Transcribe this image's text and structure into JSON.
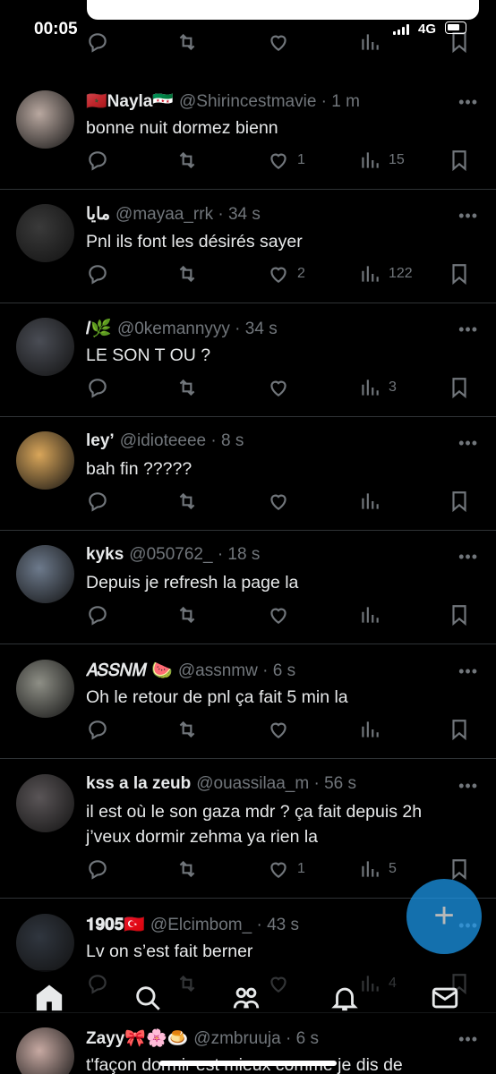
{
  "status_bar": {
    "time": "00:05",
    "network": "4G"
  },
  "colors": {
    "background": "#000000",
    "text": "#e7e9ea",
    "muted": "#71767b",
    "accent": "#1d9bf0",
    "divider": "#2f3336"
  },
  "tweets": [
    {
      "name": "🇲🇦Nayla🇸🇾",
      "handle": "@Shirincestmavie · 1 m",
      "text": "bonne nuit dormez bienn",
      "likes": "1",
      "views": "15"
    },
    {
      "name": "مايا",
      "handle": "@mayaa_rrk · 34 s",
      "text": "Pnl ils font les désirés sayer",
      "likes": "2",
      "views": "122"
    },
    {
      "name": "𝐼🌿",
      "handle": "@0kemannyyy · 34 s",
      "text": "LE SON T OU ?",
      "likes": "",
      "views": "3"
    },
    {
      "name": "ley’",
      "handle": "@idioteeee · 8 s",
      "text": "bah fin ?????",
      "likes": "",
      "views": ""
    },
    {
      "name": "kyks",
      "handle": "@050762_ · 18 s",
      "text": "Depuis je refresh la page la",
      "likes": "",
      "views": ""
    },
    {
      "name": "𝐴𝑆𝑆𝑁𝑀 🍉",
      "handle": "@assnmw · 6 s",
      "text": "Oh le retour de pnl ça fait 5 min la",
      "likes": "",
      "views": ""
    },
    {
      "name": "kss a la zeub",
      "handle": "@ouassilaa_m · 56 s",
      "text": "il est où le son gaza mdr ? ça fait depuis 2h j’veux dormir zehma ya rien la",
      "likes": "1",
      "views": "5"
    },
    {
      "name": "𝟏𝟗𝟎𝟓🇹🇷",
      "handle": "@Elcimbom_ · 43 s",
      "text": "Lv on s’est fait berner",
      "likes": "",
      "views": "4"
    },
    {
      "name": "Zayy🎀🌸🍮",
      "handle": "@zmbruuja · 6 s",
      "text": "t'façon dormir est mieux comme je dis de",
      "likes": "",
      "views": ""
    }
  ],
  "icons": {
    "reply": "reply-icon",
    "retweet": "retweet-icon",
    "like": "heart-icon",
    "views": "views-icon",
    "bookmark": "bookmark-icon",
    "more": "more-icon"
  },
  "fab": {
    "label": "+"
  },
  "nav": [
    "home-icon",
    "search-icon",
    "communities-icon",
    "notifications-icon",
    "messages-icon"
  ]
}
